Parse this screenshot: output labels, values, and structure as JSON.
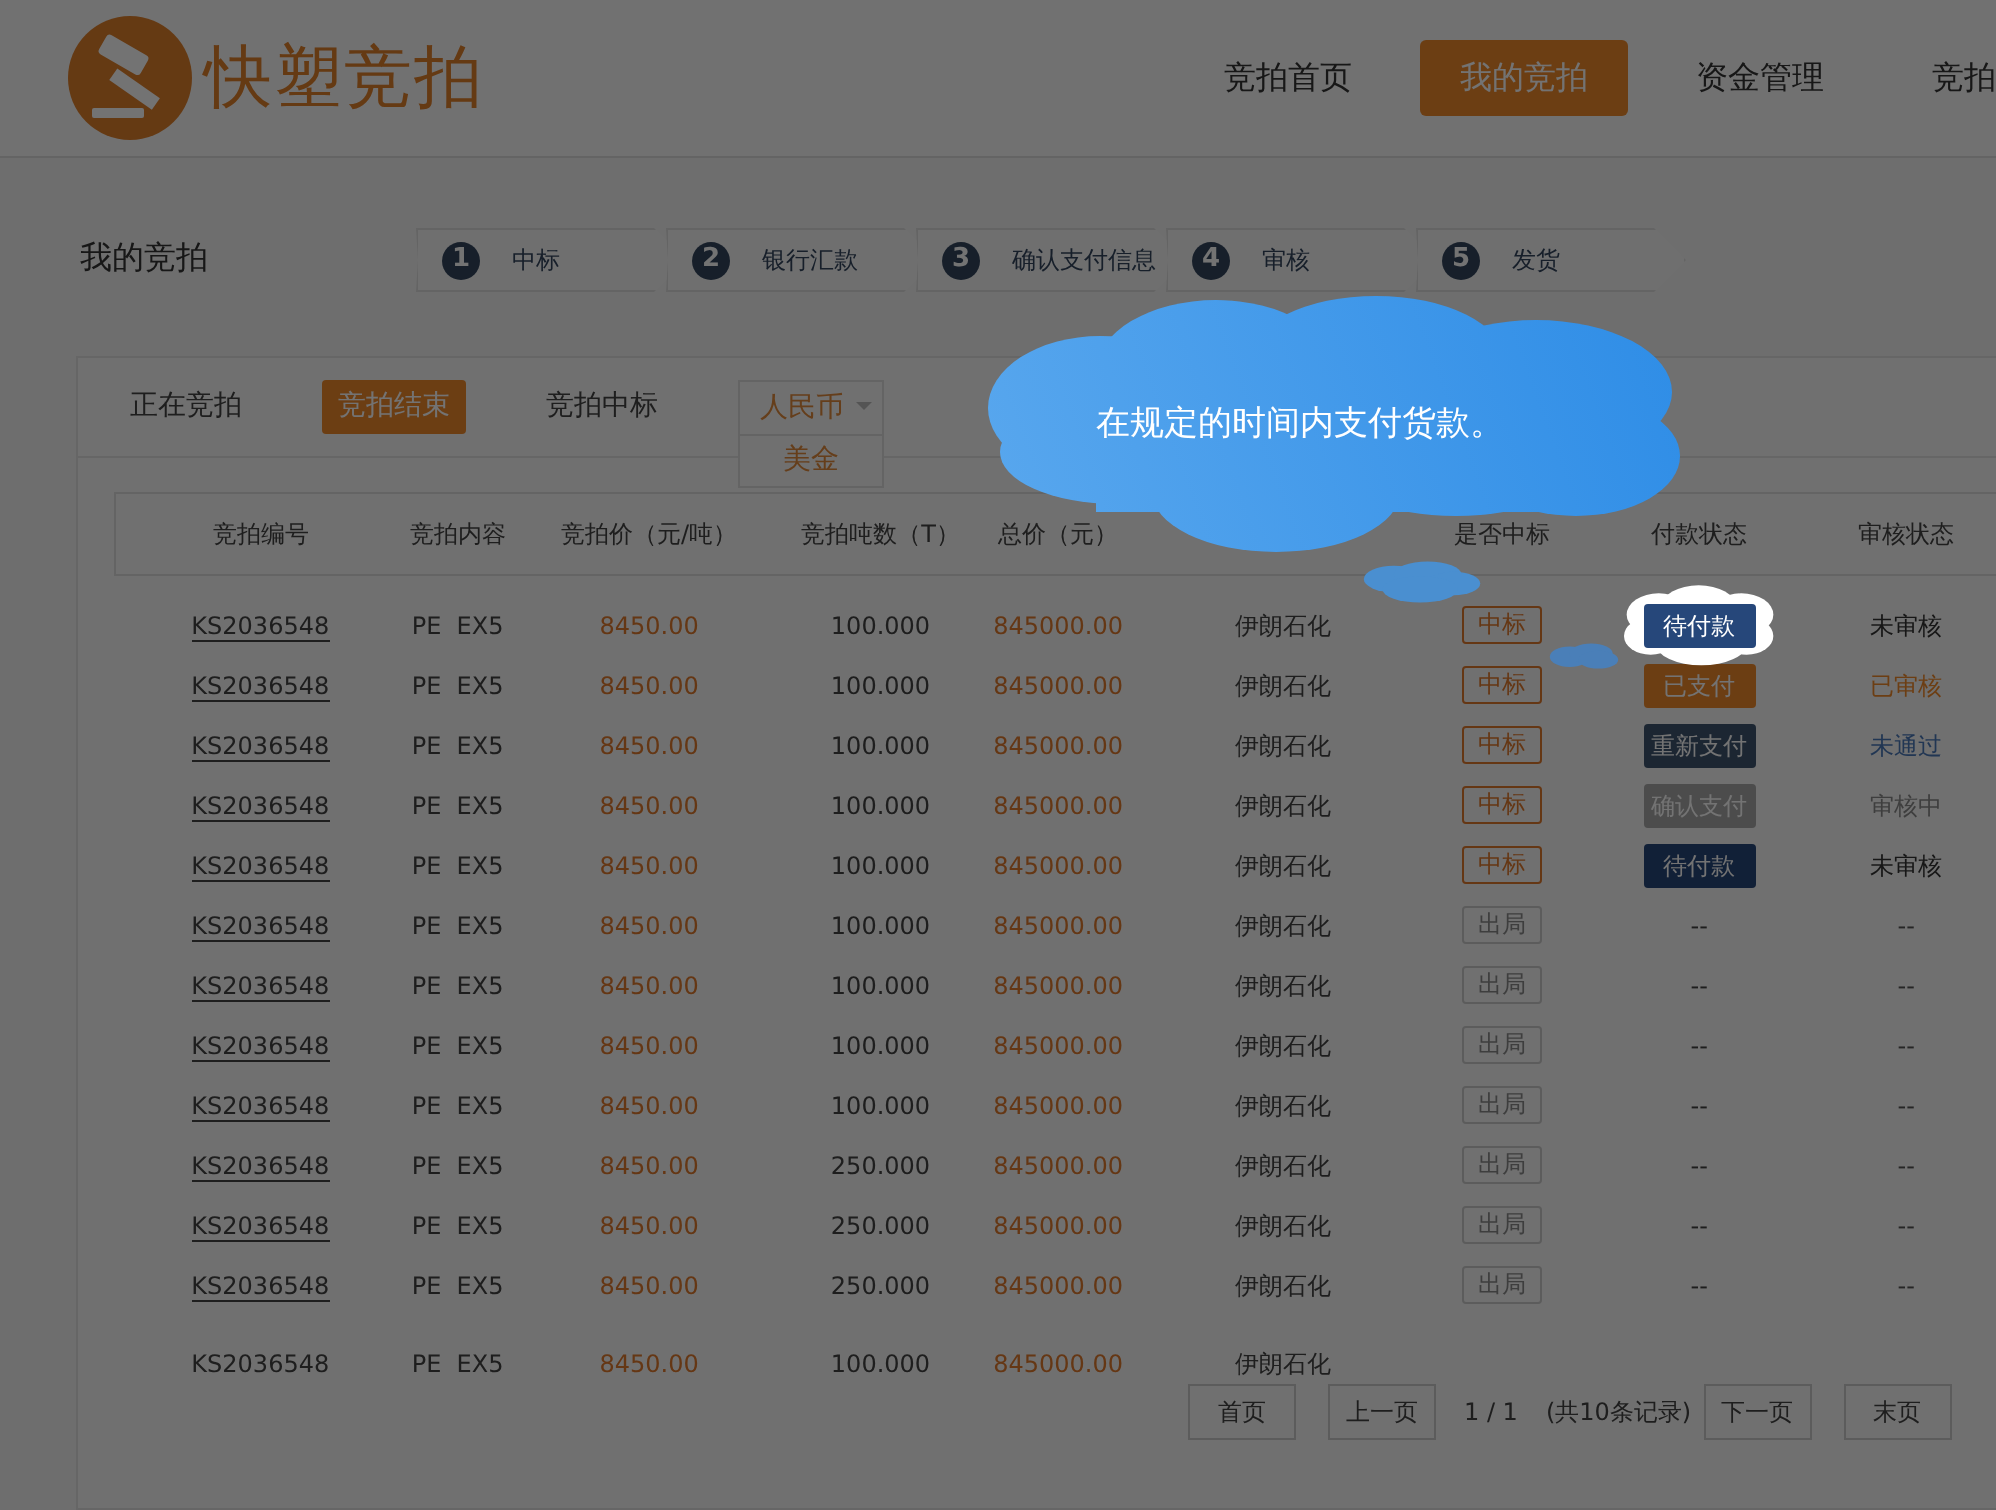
{
  "header": {
    "logo_text": "快塑竞拍",
    "nav": [
      {
        "label": "竞拍首页",
        "selected": false
      },
      {
        "label": "我的竞拍",
        "selected": true
      },
      {
        "label": "资金管理",
        "selected": false
      },
      {
        "label": "竞拍",
        "selected": false
      }
    ]
  },
  "page_title": "我的竞拍",
  "steps": [
    {
      "number": "1",
      "label": "中标"
    },
    {
      "number": "2",
      "label": "银行汇款"
    },
    {
      "number": "3",
      "label": "确认支付信息"
    },
    {
      "number": "4",
      "label": "审核"
    },
    {
      "number": "5",
      "label": "发货"
    }
  ],
  "tabs": [
    {
      "label": "正在竞拍",
      "selected": false
    },
    {
      "label": "竞拍结束",
      "selected": true
    },
    {
      "label": "竞拍中标",
      "selected": false
    }
  ],
  "currency": {
    "expanded": true,
    "options": [
      {
        "label": "人民币",
        "selected": true
      },
      {
        "label": "美金",
        "selected": false
      }
    ]
  },
  "table": {
    "columns": [
      {
        "label": "竞拍编号"
      },
      {
        "label": "竞拍内容"
      },
      {
        "label": "竞拍价（元/吨）"
      },
      {
        "label": "竞拍吨数（T）"
      },
      {
        "label": "总价（元）"
      },
      {
        "label": "是否中标"
      },
      {
        "label": "付款状态"
      },
      {
        "label": "审核状态"
      }
    ],
    "rows": [
      {
        "id": "KS2036548",
        "linked": true,
        "content": "PE  EX5",
        "price": "8450.00",
        "tons": "100.000",
        "total": "845000.00",
        "company": "伊朗石化",
        "result": {
          "kind": "won",
          "label": "中标"
        },
        "payment": {
          "kind": "pending",
          "label": "待付款",
          "highlighted": true
        },
        "review": {
          "kind": "pending",
          "label": "未审核"
        }
      },
      {
        "id": "KS2036548",
        "linked": true,
        "content": "PE  EX5",
        "price": "8450.00",
        "tons": "100.000",
        "total": "845000.00",
        "company": "伊朗石化",
        "result": {
          "kind": "won",
          "label": "中标"
        },
        "payment": {
          "kind": "paid",
          "label": "已支付"
        },
        "review": {
          "kind": "approved",
          "label": "已审核"
        }
      },
      {
        "id": "KS2036548",
        "linked": true,
        "content": "PE  EX5",
        "price": "8450.00",
        "tons": "100.000",
        "total": "845000.00",
        "company": "伊朗石化",
        "result": {
          "kind": "won",
          "label": "中标"
        },
        "payment": {
          "kind": "repay",
          "label": "重新支付"
        },
        "review": {
          "kind": "rejected",
          "label": "未通过"
        }
      },
      {
        "id": "KS2036548",
        "linked": true,
        "content": "PE  EX5",
        "price": "8450.00",
        "tons": "100.000",
        "total": "845000.00",
        "company": "伊朗石化",
        "result": {
          "kind": "won",
          "label": "中标"
        },
        "payment": {
          "kind": "confirm",
          "label": "确认支付"
        },
        "review": {
          "kind": "reviewing",
          "label": "审核中"
        }
      },
      {
        "id": "KS2036548",
        "linked": true,
        "content": "PE  EX5",
        "price": "8450.00",
        "tons": "100.000",
        "total": "845000.00",
        "company": "伊朗石化",
        "result": {
          "kind": "won",
          "label": "中标"
        },
        "payment": {
          "kind": "pending",
          "label": "待付款"
        },
        "review": {
          "kind": "pending",
          "label": "未审核"
        }
      },
      {
        "id": "KS2036548",
        "linked": true,
        "content": "PE  EX5",
        "price": "8450.00",
        "tons": "100.000",
        "total": "845000.00",
        "company": "伊朗石化",
        "result": {
          "kind": "lost",
          "label": "出局"
        },
        "payment": {
          "kind": "none",
          "label": "--",
          "highlighted": false
        },
        "review": {
          "kind": "none",
          "label": "--"
        }
      },
      {
        "id": "KS2036548",
        "linked": true,
        "content": "PE  EX5",
        "price": "8450.00",
        "tons": "100.000",
        "total": "845000.00",
        "company": "伊朗石化",
        "result": {
          "kind": "lost",
          "label": "出局"
        },
        "payment": {
          "kind": "none",
          "label": "--",
          "highlighted": false
        },
        "review": {
          "kind": "none",
          "label": "--"
        }
      },
      {
        "id": "KS2036548",
        "linked": true,
        "content": "PE  EX5",
        "price": "8450.00",
        "tons": "100.000",
        "total": "845000.00",
        "company": "伊朗石化",
        "result": {
          "kind": "lost",
          "label": "出局"
        },
        "payment": {
          "kind": "none",
          "label": "--",
          "highlighted": false
        },
        "review": {
          "kind": "none",
          "label": "--"
        }
      },
      {
        "id": "KS2036548",
        "linked": true,
        "content": "PE  EX5",
        "price": "8450.00",
        "tons": "100.000",
        "total": "845000.00",
        "company": "伊朗石化",
        "result": {
          "kind": "lost",
          "label": "出局"
        },
        "payment": {
          "kind": "none",
          "label": "--",
          "highlighted": false
        },
        "review": {
          "kind": "none",
          "label": "--"
        }
      },
      {
        "id": "KS2036548",
        "linked": true,
        "content": "PE  EX5",
        "price": "8450.00",
        "tons": "250.000",
        "total": "845000.00",
        "company": "伊朗石化",
        "result": {
          "kind": "lost",
          "label": "出局"
        },
        "payment": {
          "kind": "none",
          "label": "--",
          "highlighted": false
        },
        "review": {
          "kind": "none",
          "label": "--"
        }
      },
      {
        "id": "KS2036548",
        "linked": true,
        "content": "PE  EX5",
        "price": "8450.00",
        "tons": "250.000",
        "total": "845000.00",
        "company": "伊朗石化",
        "result": {
          "kind": "lost",
          "label": "出局"
        },
        "payment": {
          "kind": "none",
          "label": "--",
          "highlighted": false
        },
        "review": {
          "kind": "none",
          "label": "--"
        }
      },
      {
        "id": "KS2036548",
        "linked": true,
        "content": "PE  EX5",
        "price": "8450.00",
        "tons": "250.000",
        "total": "845000.00",
        "company": "伊朗石化",
        "result": {
          "kind": "lost",
          "label": "出局"
        },
        "payment": {
          "kind": "none",
          "label": "--",
          "highlighted": false
        },
        "review": {
          "kind": "none",
          "label": "--"
        }
      },
      {
        "id": "KS2036548",
        "linked": false,
        "content": "PE  EX5",
        "price": "8450.00",
        "tons": "100.000",
        "total": "845000.00",
        "company": "伊朗石化"
      }
    ]
  },
  "pagination": {
    "first": "首页",
    "prev": "上一页",
    "page": "1 / 1",
    "total": "(共10条记录)",
    "next": "下一页",
    "last": "末页"
  },
  "tooltip": {
    "text": "在规定的时间内支付货款。"
  }
}
